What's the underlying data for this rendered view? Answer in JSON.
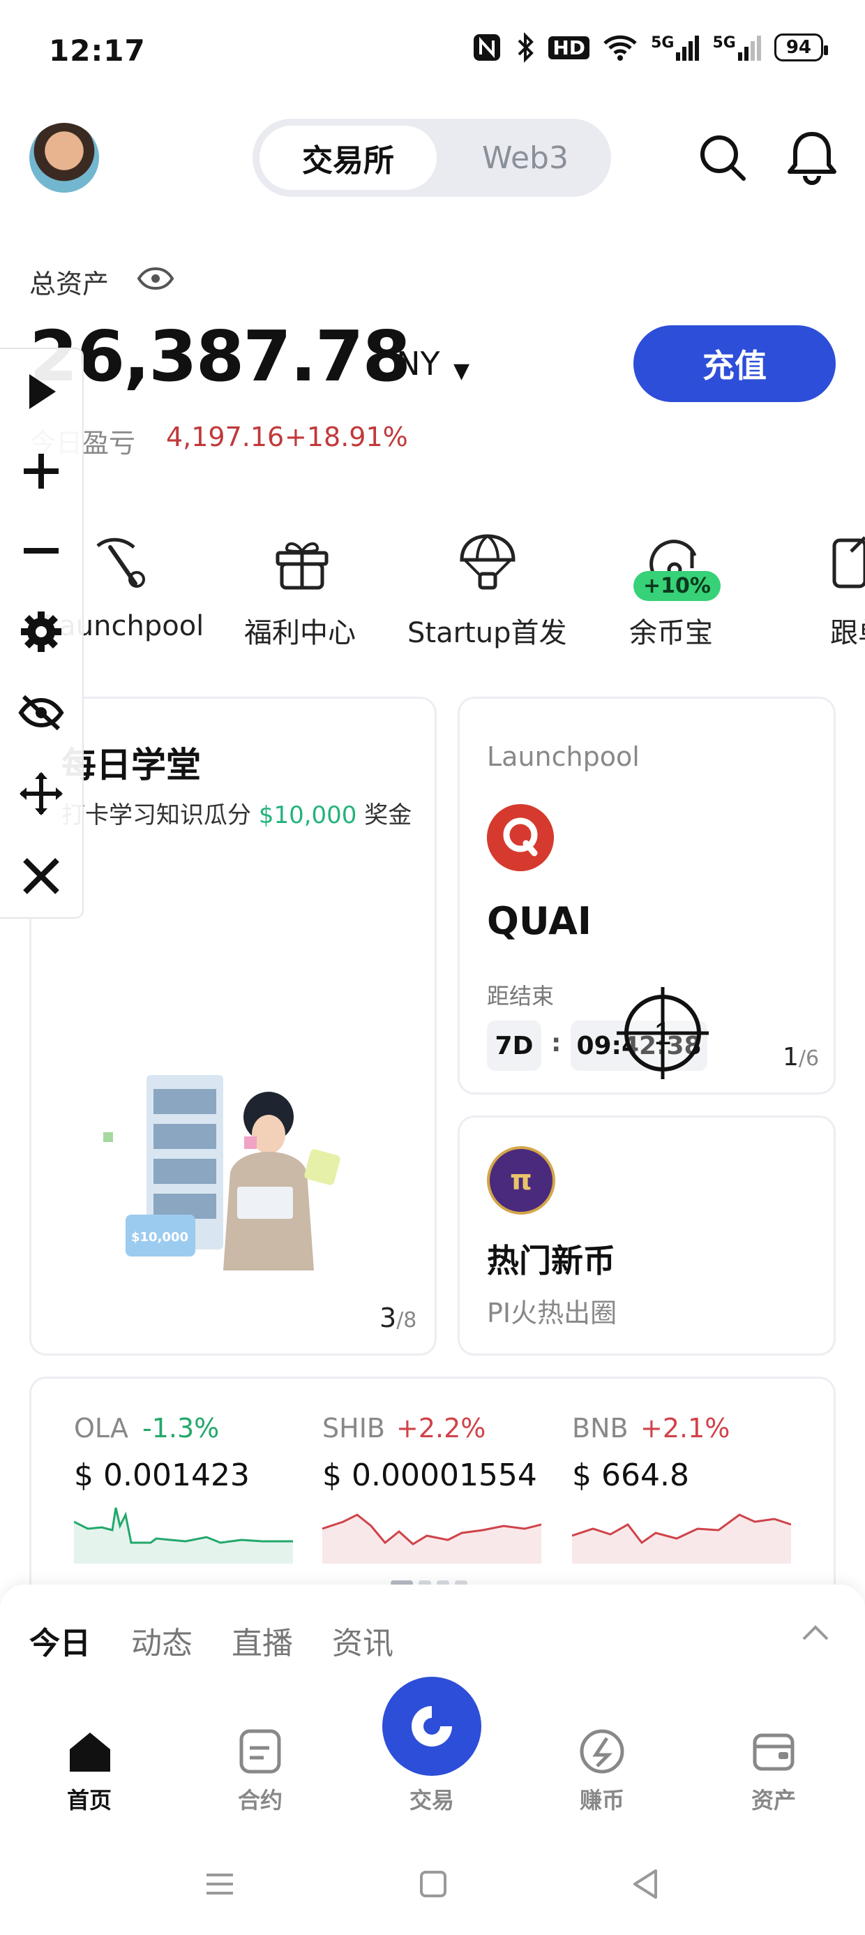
{
  "status_bar": {
    "time": "12:17",
    "icons": [
      "nfc-icon",
      "bluetooth-icon",
      "hd-icon",
      "wifi-icon",
      "signal-5g-1-icon",
      "signal-5g-2-icon"
    ],
    "network_label_1": "5G",
    "network_label_2": "5G",
    "hd_label": "HD",
    "battery": "94"
  },
  "header": {
    "segments": [
      "交易所",
      "Web3"
    ],
    "active_segment": "交易所"
  },
  "assets": {
    "label": "总资产",
    "total": "26,387.78",
    "currency": "CNY",
    "deposit_label": "充值",
    "pnl_label": "今日盈亏",
    "pnl_value": "4,197.16",
    "pnl_percent": "+18.91%"
  },
  "quick_actions": [
    {
      "label": "Launchpool",
      "icon": "pickaxe-icon"
    },
    {
      "label": "福利中心",
      "icon": "gift-icon"
    },
    {
      "label": "Startup首发",
      "icon": "parachute-icon"
    },
    {
      "label": "余币宝",
      "icon": "savings-icon",
      "badge": "+10%"
    },
    {
      "label": "跟单",
      "icon": "copy-trade-icon"
    }
  ],
  "daily_card": {
    "title": "每日学堂",
    "subtitle_prefix": "打卡学习知识瓜分",
    "subtitle_amount": "$10,000",
    "subtitle_suffix": "奖金",
    "illustration_badge": "$10,000",
    "page_current": "3",
    "page_total": "/8"
  },
  "launchpool_card": {
    "tag": "Launchpool",
    "coin": "QUAI",
    "ends_label": "距结束",
    "days": "7D",
    "colon": ":",
    "time": "09:42:38",
    "page_current": "1",
    "page_total": "/6"
  },
  "hot_card": {
    "logo_text": "π",
    "title": "热门新币",
    "subtitle": "PI火热出圈"
  },
  "tickers": [
    {
      "symbol": "OLA",
      "change": "-1.3%",
      "price": "$ 0.001423",
      "color": "#23a86b"
    },
    {
      "symbol": "SHIB",
      "change": "+2.2%",
      "price": "$ 0.00001554",
      "color": "#d0434a"
    },
    {
      "symbol": "BNB",
      "change": "+2.1%",
      "price": "$ 664.8",
      "color": "#d0434a"
    }
  ],
  "feed_tabs": [
    "今日",
    "动态",
    "直播",
    "资讯"
  ],
  "bottom_nav": [
    {
      "label": "首页",
      "icon": "home-icon"
    },
    {
      "label": "合约",
      "icon": "contract-icon"
    },
    {
      "label": "交易",
      "icon": "trade-icon"
    },
    {
      "label": "赚币",
      "icon": "earn-icon"
    },
    {
      "label": "资产",
      "icon": "wallet-icon"
    }
  ],
  "tool_panel": [
    "play-icon",
    "plus-icon",
    "minus-icon",
    "settings-icon",
    "hide-icon",
    "move-icon",
    "close-icon"
  ],
  "colors": {
    "accent": "#2d4ed8",
    "up": "#d0434a",
    "down": "#23a86b",
    "badge": "#37d177"
  }
}
